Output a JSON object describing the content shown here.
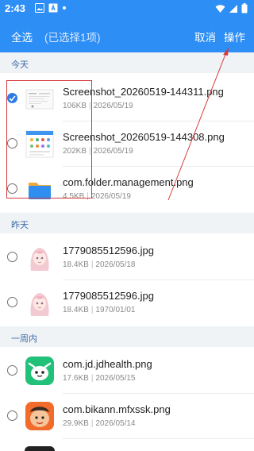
{
  "status_bar": {
    "time": "2:43"
  },
  "header": {
    "select_all": "全选",
    "selected_count": "(已选择1项)",
    "cancel": "取消",
    "actions": "操作"
  },
  "sections": [
    {
      "title": "今天",
      "items": [
        {
          "name": "Screenshot_20260519-144311.png",
          "size": "106KB",
          "date": "2026/05/19",
          "selected": true
        },
        {
          "name": "Screenshot_20260519-144308.png",
          "size": "202KB",
          "date": "2026/05/19",
          "selected": false
        },
        {
          "name": "com.folder.management.png",
          "size": "4.5KB",
          "date": "2026/05/19",
          "selected": false
        }
      ]
    },
    {
      "title": "昨天",
      "items": [
        {
          "name": "1779085512596.jpg",
          "size": "18.4KB",
          "date": "2026/05/18",
          "selected": false
        },
        {
          "name": "1779085512596.jpg",
          "size": "18.4KB",
          "date": "1970/01/01",
          "selected": false
        }
      ]
    },
    {
      "title": "一周内",
      "items": [
        {
          "name": "com.jd.jdhealth.png",
          "size": "17.6KB",
          "date": "2026/05/15",
          "selected": false
        },
        {
          "name": "com.bikann.mfxssk.png",
          "size": "29.9KB",
          "date": "2026/05/14",
          "selected": false
        }
      ]
    }
  ],
  "colors": {
    "accent": "#2d8ef5",
    "annotation": "#d63a3a"
  }
}
